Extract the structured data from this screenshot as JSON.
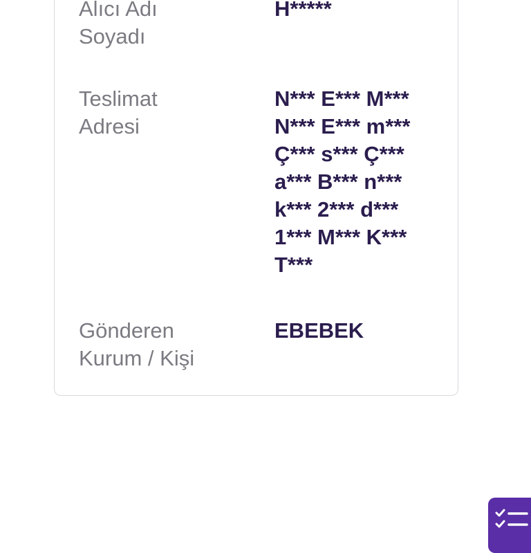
{
  "details": {
    "recipient": {
      "label": "Alıcı Adı\nSoyadı",
      "value": "H*****"
    },
    "address": {
      "label": "Teslimat\nAdresi",
      "value": "N*** E*** M***\nN*** E*** m***\nÇ*** s*** Ç***\na*** B*** n***\nk*** 2*** d***\n1*** M*** K***\nT***"
    },
    "sender": {
      "label": "Gönderen\nKurum / Kişi",
      "value": "EBEBEK"
    }
  },
  "fab": {
    "icon": "checklist-icon",
    "color": "#5a2ea6"
  }
}
